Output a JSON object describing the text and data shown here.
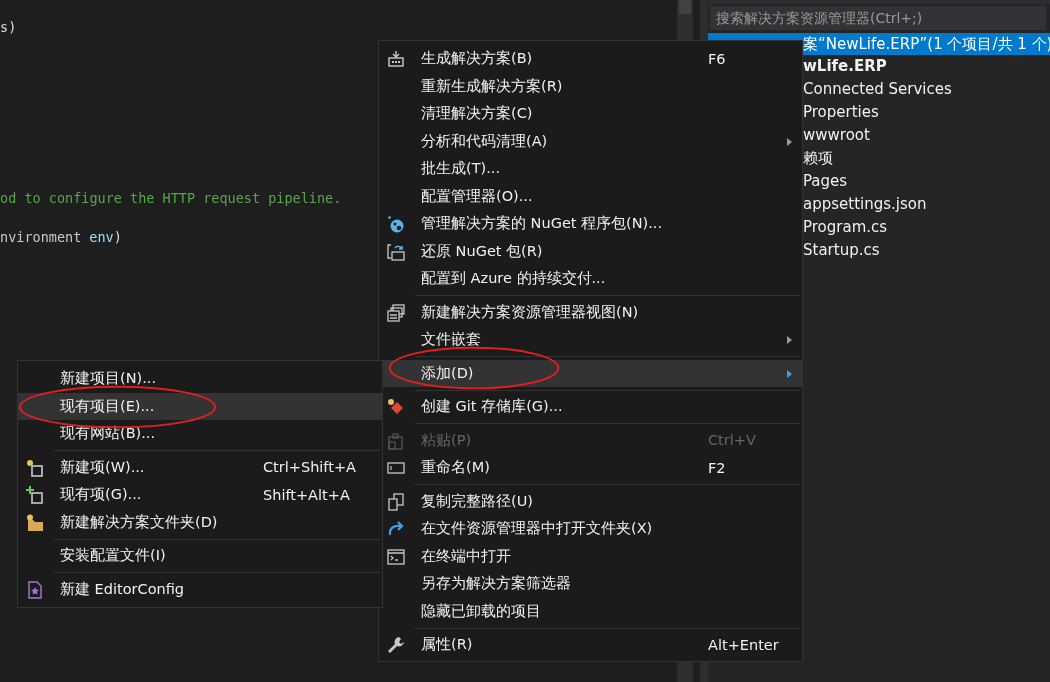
{
  "editor": {
    "code_lines": [
      [
        {
          "text": "s)",
          "kind": "plain"
        }
      ],
      [
        {
          "text": "od to configure the HTTP request pipeline.",
          "kind": "comment"
        }
      ],
      [
        {
          "text": "nvironment",
          "kind": "type"
        },
        {
          "text": "env",
          "kind": "param"
        },
        {
          "text": ")",
          "kind": "plain"
        }
      ]
    ]
  },
  "solution_explorer": {
    "search": {
      "placeholder": "搜索解决方案资源管理器(Ctrl+;)"
    },
    "header": {
      "label": "案“NewLife.ERP”(1 个项目/共 1 个)",
      "selected": true
    },
    "items": [
      {
        "label": "wLife.ERP",
        "kind": "project"
      },
      {
        "label": "Connected Services",
        "kind": "node"
      },
      {
        "label": "Properties",
        "kind": "node"
      },
      {
        "label": "wwwroot",
        "kind": "node"
      },
      {
        "label": "赖项",
        "kind": "node"
      },
      {
        "label": "Pages",
        "kind": "node"
      },
      {
        "label": "appsettings.json",
        "kind": "node"
      },
      {
        "label": "Program.cs",
        "kind": "node"
      },
      {
        "label": "Startup.cs",
        "kind": "node"
      }
    ]
  },
  "context_menu": {
    "groups": [
      [
        {
          "label": "生成解决方案(B)",
          "shortcut": "F6",
          "submenu": false,
          "disabled": false,
          "selected": false,
          "circled": false
        },
        {
          "label": "重新生成解决方案(R)",
          "submenu": false,
          "disabled": false,
          "selected": false,
          "circled": false
        },
        {
          "label": "清理解决方案(C)",
          "submenu": false,
          "disabled": false,
          "selected": false,
          "circled": false
        },
        {
          "label": "分析和代码清理(A)",
          "submenu": true,
          "disabled": false,
          "selected": false,
          "circled": false
        },
        {
          "label": "批生成(T)...",
          "submenu": false,
          "disabled": false,
          "selected": false,
          "circled": false
        },
        {
          "label": "配置管理器(O)...",
          "submenu": false,
          "disabled": false,
          "selected": false,
          "circled": false
        },
        {
          "label": "管理解决方案的 NuGet 程序包(N)...",
          "submenu": false,
          "disabled": false,
          "selected": false,
          "circled": false
        },
        {
          "label": "还原 NuGet 包(R)",
          "submenu": false,
          "disabled": false,
          "selected": false,
          "circled": false
        },
        {
          "label": "配置到 Azure 的持续交付...",
          "submenu": false,
          "disabled": false,
          "selected": false,
          "circled": false
        }
      ],
      [
        {
          "label": "新建解决方案资源管理器视图(N)",
          "submenu": false,
          "disabled": false,
          "selected": false,
          "circled": false
        },
        {
          "label": "文件嵌套",
          "submenu": true,
          "disabled": false,
          "selected": false,
          "circled": false
        }
      ],
      [
        {
          "label": "添加(D)",
          "submenu": true,
          "disabled": false,
          "selected": true,
          "circled": true
        }
      ],
      [
        {
          "label": "创建 Git 存储库(G)...",
          "submenu": false,
          "disabled": false,
          "selected": false,
          "circled": false
        }
      ],
      [
        {
          "label": "粘贴(P)",
          "shortcut": "Ctrl+V",
          "submenu": false,
          "disabled": true,
          "selected": false,
          "circled": false
        },
        {
          "label": "重命名(M)",
          "shortcut": "F2",
          "submenu": false,
          "disabled": false,
          "selected": false,
          "circled": false
        }
      ],
      [
        {
          "label": "复制完整路径(U)",
          "submenu": false,
          "disabled": false,
          "selected": false,
          "circled": false
        },
        {
          "label": "在文件资源管理器中打开文件夹(X)",
          "submenu": false,
          "disabled": false,
          "selected": false,
          "circled": false
        },
        {
          "label": "在终端中打开",
          "submenu": false,
          "disabled": false,
          "selected": false,
          "circled": false
        },
        {
          "label": "另存为解决方案筛选器",
          "submenu": false,
          "disabled": false,
          "selected": false,
          "circled": false
        },
        {
          "label": "隐藏已卸载的项目",
          "submenu": false,
          "disabled": false,
          "selected": false,
          "circled": false
        }
      ],
      [
        {
          "label": "属性(R)",
          "shortcut": "Alt+Enter",
          "submenu": false,
          "disabled": false,
          "selected": false,
          "circled": false
        }
      ]
    ]
  },
  "add_submenu": {
    "groups": [
      [
        {
          "label": "新建项目(N)...",
          "submenu": false,
          "disabled": false,
          "selected": false,
          "circled": false
        },
        {
          "label": "现有项目(E)...",
          "submenu": false,
          "disabled": false,
          "selected": true,
          "circled": true
        },
        {
          "label": "现有网站(B)...",
          "submenu": false,
          "disabled": false,
          "selected": false,
          "circled": false
        }
      ],
      [
        {
          "label": "新建项(W)...",
          "shortcut": "Ctrl+Shift+A",
          "submenu": false,
          "disabled": false,
          "selected": false,
          "circled": false
        },
        {
          "label": "现有项(G)...",
          "shortcut": "Shift+Alt+A",
          "submenu": false,
          "disabled": false,
          "selected": false,
          "circled": false
        },
        {
          "label": "新建解决方案文件夹(D)",
          "submenu": false,
          "disabled": false,
          "selected": false,
          "circled": false
        }
      ],
      [
        {
          "label": "安装配置文件(I)",
          "submenu": false,
          "disabled": false,
          "selected": false,
          "circled": false
        }
      ],
      [
        {
          "label": "新建 EditorConfig",
          "submenu": false,
          "disabled": false,
          "selected": false,
          "circled": false
        }
      ]
    ]
  }
}
